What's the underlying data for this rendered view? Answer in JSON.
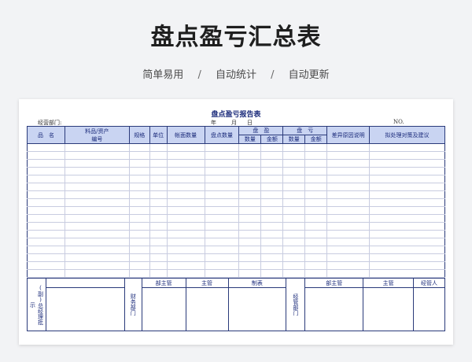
{
  "header": {
    "title": "盘点盈亏汇总表",
    "features": [
      "简单易用",
      "自动统计",
      "自动更新"
    ],
    "separator": "/"
  },
  "form": {
    "title": "盘点盈亏报告表",
    "dept_label": "经营部门:",
    "year_label": "年",
    "month_label": "月",
    "day_label": "日",
    "no_label": "NO.",
    "columns": {
      "name": "品　名",
      "item_line1": "料品/资产",
      "item_line2": "编号",
      "spec": "规格",
      "unit": "单位",
      "book_qty": "帐面数量",
      "count_qty": "盘点数量",
      "surplus": "盘　盈",
      "loss": "盘　亏",
      "qty": "数量",
      "amount": "金额",
      "reason": "差异原因说明",
      "plan": "拟处理对策及建议"
    },
    "body_rows": 17,
    "footer": {
      "gm": "(副)总经理批示",
      "finance": "财务部门",
      "dept_head": "部主管",
      "supervisor": "主管",
      "prepared": "制表",
      "operations": "经管部门",
      "handler": "经管人"
    }
  }
}
